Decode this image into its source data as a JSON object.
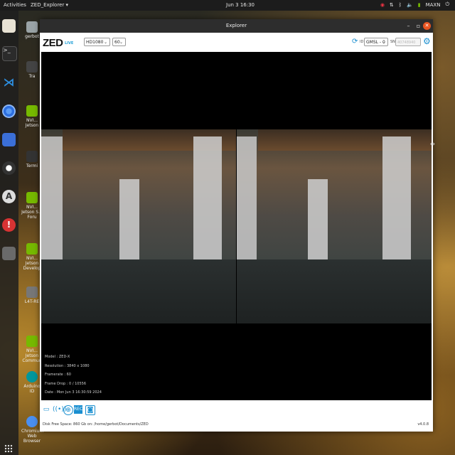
{
  "topbar": {
    "activities": "Activities",
    "app_menu": "ZED_Explorer ▾",
    "clock": "Jun 3  16:30",
    "power_mode": "MAXN"
  },
  "desktop": {
    "items": [
      {
        "label": "gerbot",
        "color": "#9aa3a6"
      },
      {
        "label": "Tra",
        "color": "#444"
      },
      {
        "label": "NVI... Jetson",
        "color": "#76b900"
      },
      {
        "label": "Termi",
        "color": "#333"
      },
      {
        "label": "NVI... Jetson S... Foru",
        "color": "#76b900"
      },
      {
        "label": "NVI... Jetson Develop",
        "color": "#76b900"
      },
      {
        "label": "L4T-RE",
        "color": "#777"
      },
      {
        "label": "NVI... Jetson Commun",
        "color": "#76b900"
      },
      {
        "label": "Arduino ID",
        "color": "#00979c"
      },
      {
        "label": "Chromium Web Browser",
        "color": "#4a8ff0"
      }
    ]
  },
  "window": {
    "title": "Explorer",
    "logo": "ZED",
    "live": "LIVE",
    "resolution": "HD1080",
    "fps": "60",
    "id_label": "ID",
    "camera_id": "GMSL - 0",
    "sn_label": "SN",
    "serial_placeholder": "40748940"
  },
  "info": {
    "model": "Model : ZED-X",
    "resolution": "Resolution : 3840 x 1080",
    "framerate": "Framerate : 60",
    "frame_drop": "Frame Drop : 0 / 10556",
    "date": "Date : Mon Jun 3 16:30:59 2024"
  },
  "status": {
    "disk": "Disk Free Space: 860 Gb  on: /home/gerbot/Documents/ZED",
    "version": "v4.0.8"
  }
}
